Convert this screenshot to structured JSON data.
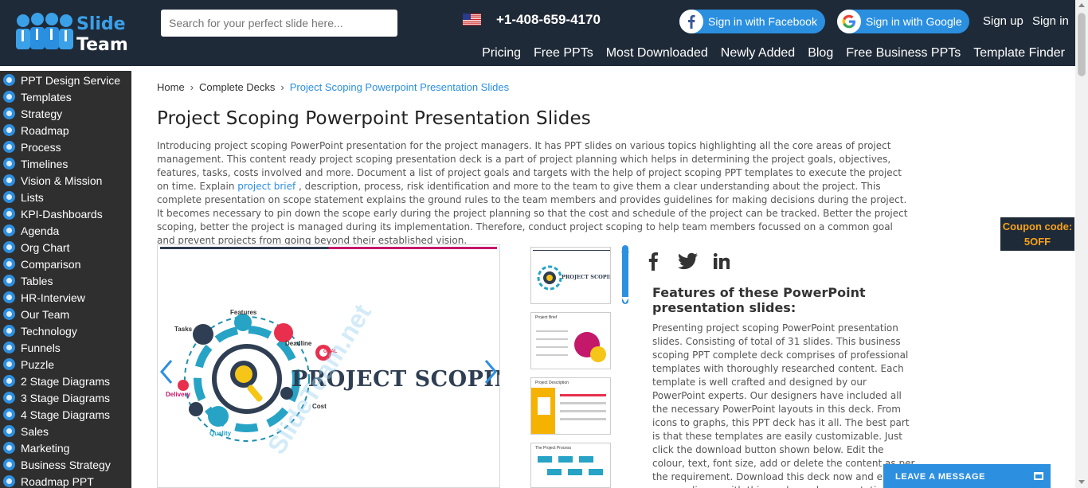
{
  "header": {
    "logo_line1": "Slide",
    "logo_line2": "Team",
    "search_placeholder": "Search for your perfect slide here...",
    "phone": "+1-408-659-4170",
    "facebook_label": "Sign in with Facebook",
    "google_label": "Sign in with Google",
    "signup_label": "Sign up",
    "signin_label": "Sign in",
    "nav": [
      "Pricing",
      "Free PPTs",
      "Most Downloaded",
      "Newly Added",
      "Blog",
      "Free Business PPTs",
      "Template Finder"
    ]
  },
  "sidebar": {
    "items": [
      {
        "label": "PPT Design Service",
        "icon": "design-service-icon"
      },
      {
        "label": "Templates",
        "icon": "templates-icon"
      },
      {
        "label": "Strategy",
        "icon": "strategy-icon"
      },
      {
        "label": "Roadmap",
        "icon": "roadmap-icon"
      },
      {
        "label": "Process",
        "icon": "process-icon"
      },
      {
        "label": "Timelines",
        "icon": "timelines-icon"
      },
      {
        "label": "Vision & Mission",
        "icon": "vision-icon"
      },
      {
        "label": "Lists",
        "icon": "lists-icon"
      },
      {
        "label": "KPI-Dashboards",
        "icon": "kpi-icon"
      },
      {
        "label": "Agenda",
        "icon": "agenda-icon"
      },
      {
        "label": "Org Chart",
        "icon": "org-chart-icon"
      },
      {
        "label": "Comparison",
        "icon": "comparison-icon"
      },
      {
        "label": "Tables",
        "icon": "tables-icon"
      },
      {
        "label": "HR-Interview",
        "icon": "hr-icon"
      },
      {
        "label": "Our Team",
        "icon": "team-icon"
      },
      {
        "label": "Technology",
        "icon": "technology-icon"
      },
      {
        "label": "Funnels",
        "icon": "funnel-icon"
      },
      {
        "label": "Puzzle",
        "icon": "puzzle-icon"
      },
      {
        "label": "2 Stage Diagrams",
        "icon": "stage-2-icon"
      },
      {
        "label": "3 Stage Diagrams",
        "icon": "stage-3-icon"
      },
      {
        "label": "4 Stage Diagrams",
        "icon": "stage-4-icon"
      },
      {
        "label": "Sales",
        "icon": "sales-icon"
      },
      {
        "label": "Marketing",
        "icon": "marketing-icon"
      },
      {
        "label": "Business Strategy",
        "icon": "business-strategy-icon"
      },
      {
        "label": "Roadmap PPT",
        "icon": "roadmap-ppt-icon"
      }
    ]
  },
  "breadcrumb": {
    "home": "Home",
    "parent": "Complete Decks",
    "current": "Project Scoping Powerpoint Presentation Slides"
  },
  "product": {
    "title": "Project Scoping Powerpoint Presentation Slides",
    "intro_before_link": "Introducing project scoping PowerPoint presentation for the project managers. It has PPT slides on various topics highlighting all the core areas of project management. This content ready project scoping presentation deck is a part of project planning which helps in determining the project goals, objectives, features, tasks, costs involved and more. Document a list of project goals and targets with the help of project scoping PPT templates to execute the project on time. Explain ",
    "intro_link": "project brief",
    "intro_after_link": " , description, process, risk identification and more to the team to give them a clear understanding about the project. This complete presentation on scope statement explains the ground rules to the team members and provides guidelines for making decisions during the project. It becomes necessary to pin down the scope early during the project planning so that the cost and schedule of the project can be tracked. Better the project scoping, better the project is managed during its implementation. Therefore, conduct project scoping to help team members focussed on a common goal and prevent projects from going beyond their established vision."
  },
  "main_slide": {
    "title_text": "PROJECT SCOPING",
    "labels": {
      "features": "Features",
      "tasks": "Tasks",
      "deadline": "Deadline",
      "goal": "GOAL",
      "delivery": "Delivery",
      "cost": "Cost",
      "quality": "Quality"
    },
    "watermark": "SlideTeam.net"
  },
  "thumbnails": [
    {
      "title": "PROJECT SCOPING"
    },
    {
      "title": "Project Brief"
    },
    {
      "title": "Project Description"
    },
    {
      "title": "The Project Process"
    }
  ],
  "features": {
    "title": "Features of these PowerPoint presentation slides:",
    "body": "Presenting project scoping PowerPoint presentation slides. Consisting of total of 31 slides. This business scoping PPT complete deck comprises of professional templates with thoroughly researched content. Each template is well crafted and designed by our PowerPoint experts. Our designers have included all the necessary PowerPoint layouts in this deck. From icons to graphs, this PPT deck has it all. The best part is that these templates are easily customizable. Just click the download button shown below. Edit the colour, text, font size, add or delete the content as per the requirement. Download this deck now and engage your audience with this ready made presentation."
  },
  "coupon": {
    "line1": "Coupon code:",
    "line2": "5OFF"
  },
  "chat": {
    "label": "LEAVE A MESSAGE"
  },
  "colors": {
    "header_bg": "#1f2a38",
    "accent": "#2b8fe0",
    "sidebar_bg": "#2f2f2f",
    "coupon_text": "#f6a21a"
  }
}
